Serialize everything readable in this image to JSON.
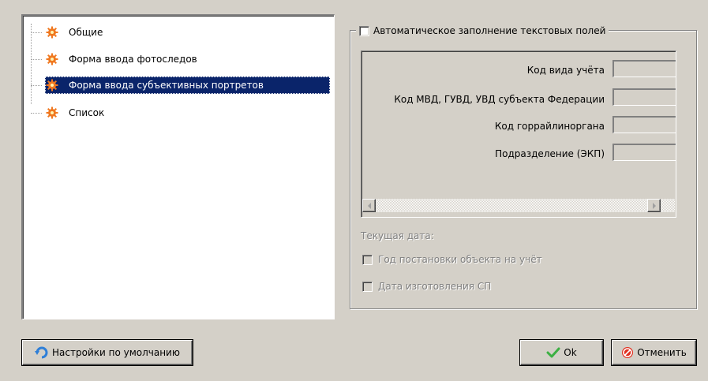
{
  "tree": {
    "items": [
      {
        "label": "Общие",
        "icon": "gear-icon",
        "selected": false
      },
      {
        "label": "Форма ввода фотоследов",
        "icon": "gear-icon",
        "selected": false
      },
      {
        "label": "Форма ввода субъективных портретов",
        "icon": "gear-icon",
        "selected": true
      },
      {
        "label": "Список",
        "icon": "gear-icon",
        "selected": false
      }
    ]
  },
  "autofill": {
    "label": "Автоматическое заполнение текстовых полей",
    "checked": false,
    "fields": [
      {
        "label": "Код вида учёта",
        "value": ""
      },
      {
        "label": "Код МВД, ГУВД, УВД субъекта Федерации",
        "value": ""
      },
      {
        "label": "Код горрайлиноргана",
        "value": ""
      },
      {
        "label": "Подразделение (ЭКП)",
        "value": ""
      }
    ]
  },
  "current_date": {
    "label": "Текущая дата:",
    "options": [
      {
        "label": "Год постановки объекта на учёт",
        "checked": false,
        "enabled": false
      },
      {
        "label": "Дата изготовления СП",
        "checked": false,
        "enabled": false
      }
    ]
  },
  "buttons": {
    "defaults": "Настройки по умолчанию",
    "ok": "Ok",
    "cancel": "Отменить"
  },
  "colors": {
    "background": "#d4d0c8",
    "selection": "#0a246a",
    "gear_orange": "#f07820",
    "ok_green": "#3cb043",
    "cancel_red": "#e03020",
    "undo_blue": "#2f7fd8"
  }
}
